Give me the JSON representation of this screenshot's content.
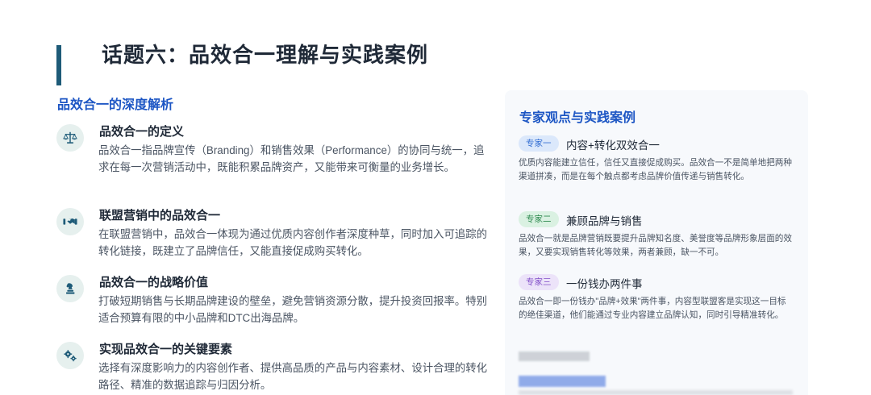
{
  "page_title": "话题六：品效合一理解与实践案例",
  "left": {
    "heading": "品效合一的深度解析",
    "items": [
      {
        "icon": "balance-scale-icon",
        "title": "品效合一的定义",
        "text": "品效合一指品牌宣传（Branding）和销售效果（Performance）的协同与统一，追求在每一次营销活动中，既能积累品牌资产，又能带来可衡量的业务增长。"
      },
      {
        "icon": "handshake-icon",
        "title": "联盟营销中的品效合一",
        "text": "在联盟营销中，品效合一体现为通过优质内容创作者深度种草，同时加入可追踪的转化链接，既建立了品牌信任，又能直接促成购买转化。"
      },
      {
        "icon": "chess-piece-icon",
        "title": "品效合一的战略价值",
        "text": "打破短期销售与长期品牌建设的壁垒，避免营销资源分散，提升投资回报率。特别适合预算有限的中小品牌和DTC出海品牌。"
      },
      {
        "icon": "gears-icon",
        "title": "实现品效合一的关键要素",
        "text": "选择有深度影响力的内容创作者、提供高品质的产品与内容素材、设计合理的转化路径、精准的数据追踪与归因分析。"
      }
    ]
  },
  "right": {
    "heading": "专家观点与实践案例",
    "experts": [
      {
        "tag": "专家一",
        "title": "内容+转化双效合一",
        "text": "优质内容能建立信任，信任又直接促成购买。品效合一不是简单地把两种渠道拼凑，而是在每个触点都考虑品牌价值传递与销售转化。"
      },
      {
        "tag": "专家二",
        "title": "兼顾品牌与销售",
        "text": "品效合一就是品牌营销既要提升品牌知名度、美誉度等品牌形象层面的效果，又要实现销售转化等效果，两者兼顾，缺一不可。"
      },
      {
        "tag": "专家三",
        "title": "一份钱办两件事",
        "text": "品效合一即一份钱办\"品牌+效果\"两件事，内容型联盟客是实现这一目标的绝佳渠道，他们能通过专业内容建立品牌认知，同时引导精准转化。"
      }
    ]
  },
  "colors": {
    "accent": "#1d56c4",
    "title_bar": "#1e5b78",
    "icon_bg": "#e6f0ee",
    "icon_fg": "#1e5b78",
    "panel_bg": "#f7f9fc"
  }
}
